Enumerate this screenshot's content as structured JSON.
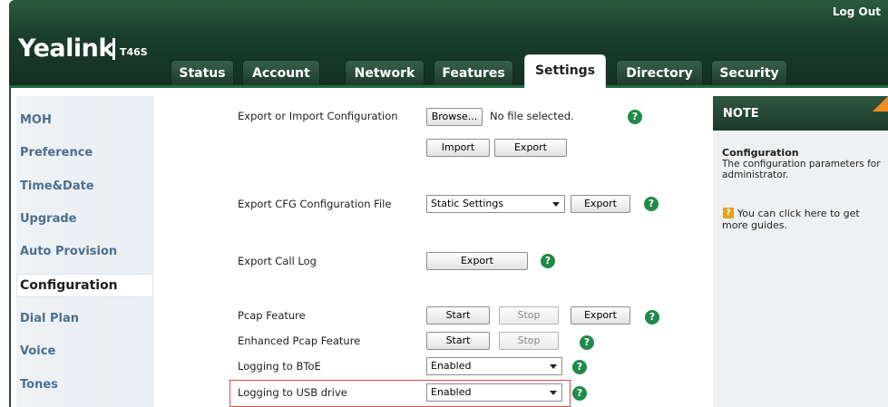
{
  "header": {
    "logo_text": "Yealink",
    "model": "T46S",
    "logout_label": "Log Out"
  },
  "tabs": [
    "Status",
    "Account",
    "Network",
    "Features",
    "Settings",
    "Directory",
    "Security"
  ],
  "active_tab": "Settings",
  "sidebar": {
    "items": [
      "MOH",
      "Preference",
      "Time&Date",
      "Upgrade",
      "Auto Provision",
      "Configuration",
      "Dial Plan",
      "Voice",
      "Tones"
    ],
    "active": "Configuration"
  },
  "main": {
    "export_import": {
      "label": "Export or Import Configuration",
      "browse_label": "Browse...",
      "file_status": "No file selected.",
      "import_label": "Import",
      "export_label": "Export"
    },
    "export_cfg": {
      "label": "Export CFG Configuration File",
      "select_value": "Static Settings",
      "export_label": "Export"
    },
    "export_call_log": {
      "label": "Export Call Log",
      "export_label": "Export"
    },
    "pcap": {
      "label": "Pcap Feature",
      "start_label": "Start",
      "stop_label": "Stop",
      "export_label": "Export"
    },
    "enhanced_pcap": {
      "label": "Enhanced Pcap Feature",
      "start_label": "Start",
      "stop_label": "Stop"
    },
    "logging_btoe": {
      "label": "Logging to BToE",
      "value": "Enabled"
    },
    "logging_usb": {
      "label": "Logging to USB drive",
      "value": "Enabled"
    },
    "help_glyph": "?"
  },
  "note": {
    "title": "NOTE",
    "subtitle": "Configuration",
    "text": "The configuration parameters for administrator.",
    "link_text": "You can click here to get more guides."
  },
  "colors": {
    "header_green": "#1c3b28",
    "help_green": "#1f8a4a",
    "sidebar_link": "#4d6f8f",
    "highlight_red": "#e04848",
    "note_corner": "#f08b1f"
  }
}
